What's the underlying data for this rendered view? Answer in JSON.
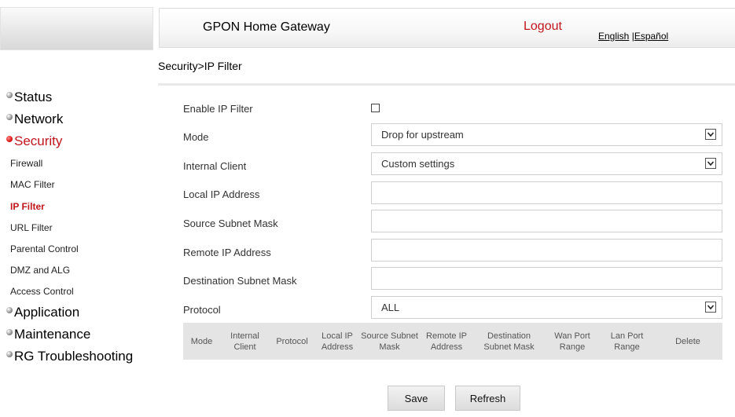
{
  "header": {
    "title": "GPON Home Gateway",
    "logout": "Logout",
    "lang_english": "English",
    "lang_separator": "|",
    "lang_espanol": "Español"
  },
  "breadcrumb": "Security>IP Filter",
  "sidebar": {
    "sections": [
      {
        "label": "Status"
      },
      {
        "label": "Network"
      },
      {
        "label": "Security"
      },
      {
        "label": "Application"
      },
      {
        "label": "Maintenance"
      },
      {
        "label": "RG Troubleshooting"
      }
    ],
    "security_items": [
      {
        "label": "Firewall"
      },
      {
        "label": "MAC Filter"
      },
      {
        "label": "IP Filter"
      },
      {
        "label": "URL Filter"
      },
      {
        "label": "Parental Control"
      },
      {
        "label": "DMZ and ALG"
      },
      {
        "label": "Access Control"
      }
    ]
  },
  "form": {
    "enable_label": "Enable IP Filter",
    "enable_checked": false,
    "mode_label": "Mode",
    "mode_value": "Drop for upstream",
    "internal_client_label": "Internal Client",
    "internal_client_value": "Custom settings",
    "local_ip_label": "Local IP Address",
    "local_ip_value": "",
    "source_mask_label": "Source Subnet Mask",
    "source_mask_value": "",
    "remote_ip_label": "Remote IP Address",
    "remote_ip_value": "",
    "dest_mask_label": "Destination Subnet Mask",
    "dest_mask_value": "",
    "protocol_label": "Protocol",
    "protocol_value": "ALL"
  },
  "table": {
    "columns": [
      "Mode",
      "Internal Client",
      "Protocol",
      "Local IP Address",
      "Source Subnet Mask",
      "Remote IP Address",
      "Destination Subnet Mask",
      "Wan Port Range",
      "Lan Port Range",
      "Delete"
    ]
  },
  "buttons": {
    "save": "Save",
    "refresh": "Refresh"
  },
  "colors": {
    "accent_red": "#c0161d",
    "table_header_bg": "#e4e4e4"
  }
}
